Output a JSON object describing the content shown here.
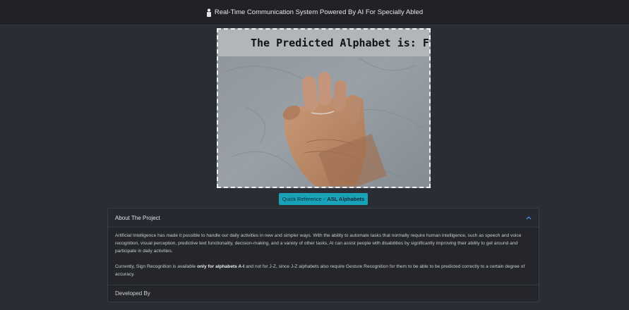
{
  "header": {
    "title": "Real-Time Communication System Powered By AI For Specially Abled",
    "icon": "person-icon"
  },
  "feed": {
    "overlay_text": "The Predicted Alphabet is: F"
  },
  "reference_button": {
    "prefix": "Quick Reference -",
    "bold": "ASL Alphabets"
  },
  "accordion": {
    "header": "About The Project",
    "paragraph1": "Artificial Intelligence has made it possible to handle our daily activities in new and simpler ways. With the ability to automate tasks that normally require human intelligence, such as speech and voice recognition, visual perception, predictive text functionality, decision-making, and a variety of other tasks, AI can assist people with disabilities by significantly improving their ability to get around and participate in daily activities.",
    "paragraph2_pre": "Currently, Sign Recognition is available ",
    "paragraph2_bold": "only for alphabets A-I",
    "paragraph2_post": " and not for J-Z, since J-Z alphabets also require Gesture Recognition for them to be able to be predicted correctly to a certain degree of accuracy.",
    "footer": "Developed By"
  },
  "colors": {
    "background": "#2a2d34",
    "navbar": "#202226",
    "accent": "#17a2b8"
  }
}
